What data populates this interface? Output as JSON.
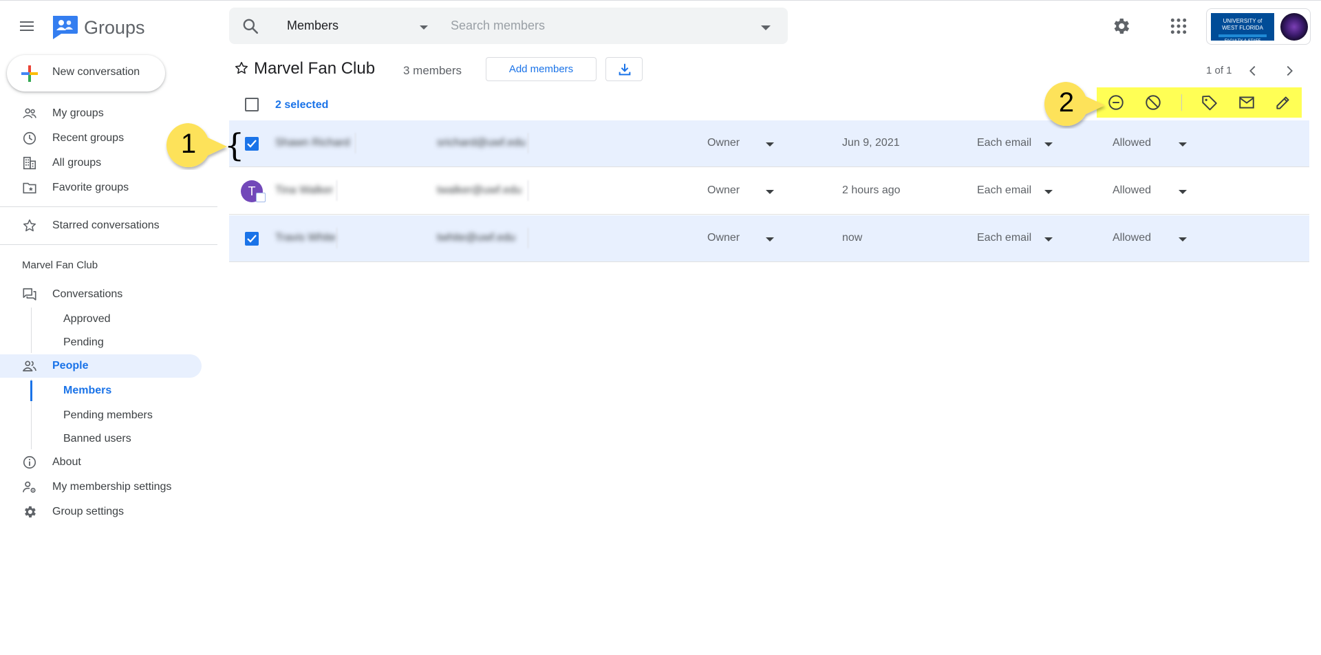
{
  "app": {
    "name": "Groups"
  },
  "search": {
    "scope": "Members",
    "placeholder": "Search members"
  },
  "account": {
    "org_line1": "UNIVERSITY of",
    "org_line2": "WEST FLORIDA",
    "org_line3": "FACULTY & STAFF"
  },
  "sidebar": {
    "new_conversation": "New conversation",
    "nav": [
      {
        "label": "My groups",
        "icon": "people-outline-icon"
      },
      {
        "label": "Recent groups",
        "icon": "clock-icon"
      },
      {
        "label": "All groups",
        "icon": "building-icon"
      },
      {
        "label": "Favorite groups",
        "icon": "folder-star-icon"
      }
    ],
    "starred": "Starred conversations",
    "group_section": "Marvel Fan Club",
    "conversations": "Conversations",
    "conv_sub": [
      "Approved",
      "Pending"
    ],
    "people": "People",
    "people_sub": [
      "Members",
      "Pending members",
      "Banned users"
    ],
    "about": "About",
    "membership_settings": "My membership settings",
    "group_settings": "Group settings"
  },
  "main": {
    "title": "Marvel Fan Club",
    "member_count": "3 members",
    "add_members": "Add members",
    "pager": "1 of 1",
    "selected": "2 selected"
  },
  "members": [
    {
      "name": "Shawn Richard",
      "email": "srichard@uwf.edu",
      "role": "Owner",
      "date": "Jun 9, 2021",
      "delivery": "Each email",
      "posting": "Allowed",
      "selected": true,
      "avatar": ""
    },
    {
      "name": "Tina Walker",
      "email": "twalker@uwf.edu",
      "role": "Owner",
      "date": "2 hours ago",
      "delivery": "Each email",
      "posting": "Allowed",
      "selected": false,
      "avatar": "T"
    },
    {
      "name": "Travis White",
      "email": "twhite@uwf.edu",
      "role": "Owner",
      "date": "now",
      "delivery": "Each email",
      "posting": "Allowed",
      "selected": true,
      "avatar": ""
    }
  ],
  "callouts": {
    "one": "1",
    "two": "2"
  },
  "colors": {
    "accent": "#1a73e8",
    "selected_row": "#e8f0fe",
    "highlight": "#ffff55",
    "callout": "#fde25a"
  }
}
